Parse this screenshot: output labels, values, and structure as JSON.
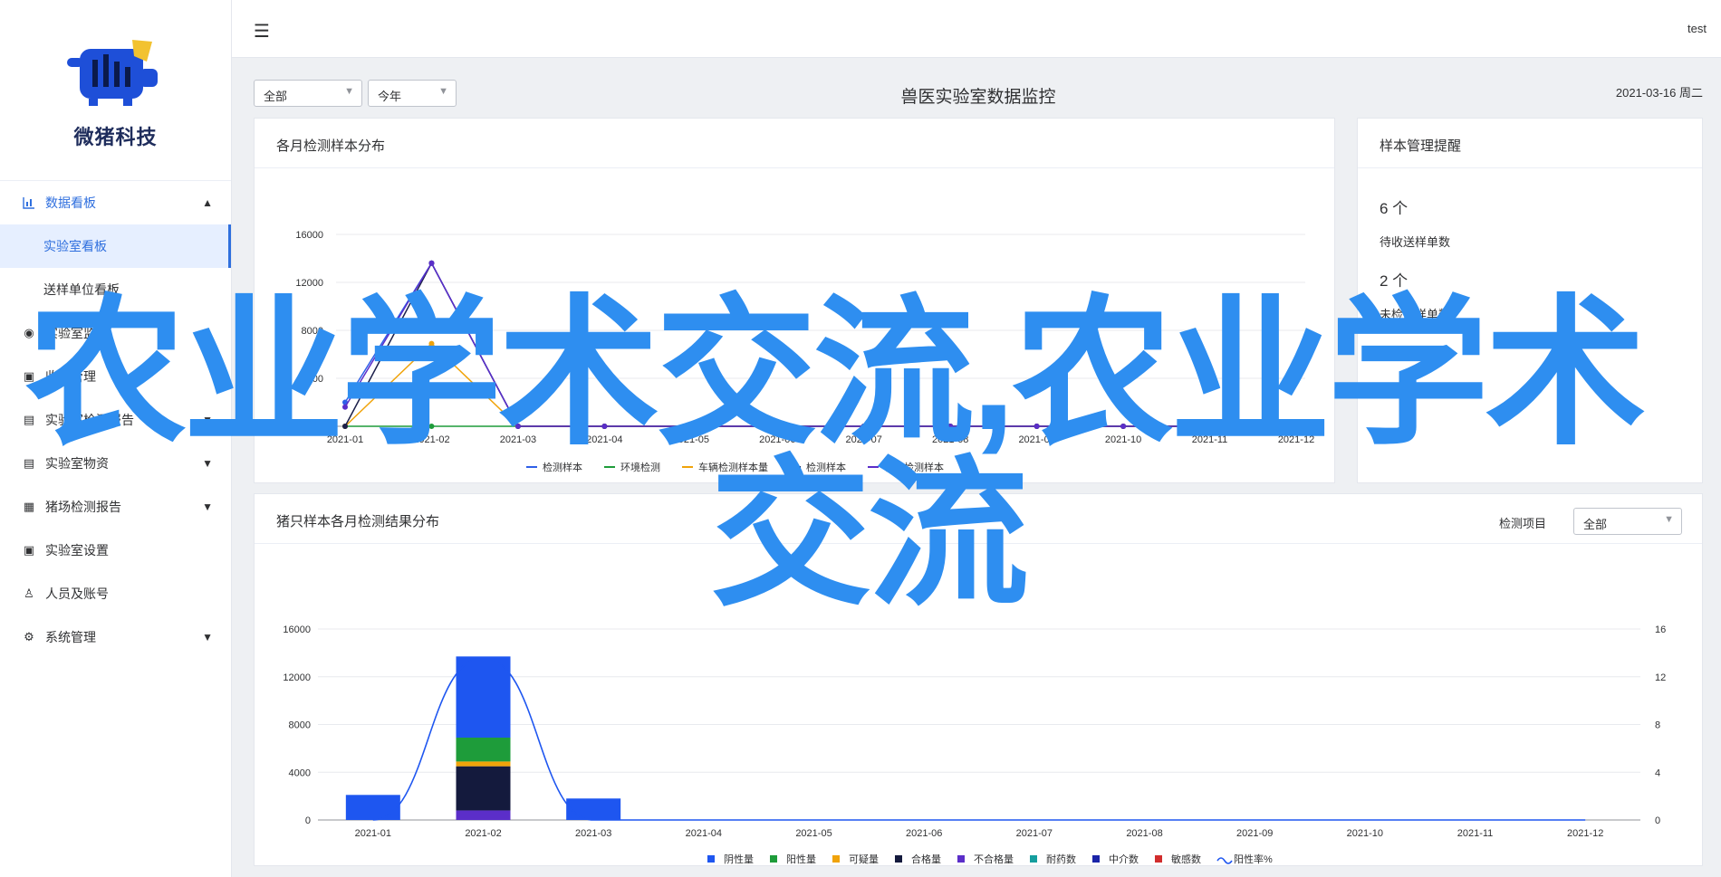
{
  "app": {
    "brand": "微猪科技",
    "user": "test"
  },
  "sidebar": {
    "items": [
      {
        "label": "数据看板",
        "icon": "bar-chart-icon"
      },
      {
        "label": "实验室看板"
      },
      {
        "label": "送样单位看板"
      },
      {
        "label": "实验室监控",
        "icon": "eye-icon"
      },
      {
        "label": "收样管理",
        "icon": "lock-icon"
      },
      {
        "label": "实验室检测报告",
        "icon": "document-icon"
      },
      {
        "label": "实验室物资",
        "icon": "document-icon"
      },
      {
        "label": "猪场检测报告",
        "icon": "report-icon"
      },
      {
        "label": "实验室设置",
        "icon": "lock-icon"
      },
      {
        "label": "人员及账号",
        "icon": "user-icon"
      },
      {
        "label": "系统管理",
        "icon": "gear-icon"
      }
    ]
  },
  "filters": {
    "scope": "全部",
    "period": "今年"
  },
  "page": {
    "title": "兽医实验室数据监控",
    "date": "2021-03-16 周二"
  },
  "sample_dist": {
    "title": "各月检测样本分布"
  },
  "reminder": {
    "title": "样本管理提醒",
    "pending_count": "6 个",
    "pending_label": "待收送样单数",
    "unchecked_count": "2 个",
    "unchecked_label": "未检送样单数"
  },
  "pig_dist": {
    "title": "猪只样本各月检测结果分布",
    "filter_label": "检测项目",
    "filter_value": "全部"
  },
  "watermark": {
    "line1": "农业学术交流,农业学术",
    "line2": "交流"
  },
  "chart_data": [
    {
      "type": "line",
      "categories": [
        "2021-01",
        "2021-02",
        "2021-03",
        "2021-04",
        "2021-05",
        "2021-06",
        "2021-07",
        "2021-08",
        "2021-09",
        "2021-10",
        "2021-11",
        "2021-12"
      ],
      "ylim": [
        0,
        16000
      ],
      "yticks": [
        0,
        4000,
        8000,
        12000,
        16000
      ],
      "series": [
        {
          "name": "检测样本",
          "color": "#2f5fe8",
          "values": [
            2000,
            13600,
            0,
            0,
            0,
            0,
            0,
            0,
            0,
            0,
            0,
            0
          ]
        },
        {
          "name": "环境检测",
          "color": "#1e9c3a",
          "values": [
            0,
            0,
            0,
            0,
            0,
            0,
            0,
            0,
            0,
            0,
            0,
            0
          ]
        },
        {
          "name": "车辆检测样本量",
          "color": "#f0a30a",
          "values": [
            0,
            6900,
            0,
            0,
            0,
            0,
            0,
            0,
            0,
            0,
            0,
            0
          ]
        },
        {
          "name": "检测样本",
          "color": "#1b1f4a",
          "values": [
            0,
            13600,
            0,
            0,
            0,
            0,
            0,
            0,
            0,
            0,
            0,
            0
          ]
        },
        {
          "name": "物资检测样本",
          "color": "#5b2ec9",
          "values": [
            1600,
            13600,
            0,
            0,
            0,
            0,
            0,
            0,
            0,
            0,
            0,
            0
          ]
        }
      ]
    },
    {
      "type": "bar",
      "categories": [
        "2021-01",
        "2021-02",
        "2021-03",
        "2021-04",
        "2021-05",
        "2021-06",
        "2021-07",
        "2021-08",
        "2021-09",
        "2021-10",
        "2021-11",
        "2021-12"
      ],
      "ylim": [
        0,
        16000
      ],
      "yticks": [
        0,
        4000,
        8000,
        12000,
        16000
      ],
      "y2lim": [
        0,
        16
      ],
      "y2ticks": [
        0,
        4,
        8,
        12,
        16
      ],
      "series": [
        {
          "name": "阴性量",
          "color": "#1e56f0",
          "values": [
            2100,
            6800,
            1800,
            0,
            0,
            0,
            0,
            0,
            0,
            0,
            0,
            0
          ]
        },
        {
          "name": "阳性量",
          "color": "#1e9c3a",
          "values": [
            0,
            2000,
            0,
            0,
            0,
            0,
            0,
            0,
            0,
            0,
            0,
            0
          ]
        },
        {
          "name": "可疑量",
          "color": "#f0a30a",
          "values": [
            0,
            400,
            0,
            0,
            0,
            0,
            0,
            0,
            0,
            0,
            0,
            0
          ]
        },
        {
          "name": "合格量",
          "color": "#141a3d",
          "values": [
            0,
            3700,
            0,
            0,
            0,
            0,
            0,
            0,
            0,
            0,
            0,
            0
          ]
        },
        {
          "name": "不合格量",
          "color": "#5b2ec9",
          "values": [
            0,
            800,
            0,
            0,
            0,
            0,
            0,
            0,
            0,
            0,
            0,
            0
          ]
        },
        {
          "name": "耐药数",
          "color": "#159e9e",
          "values": [
            0,
            0,
            0,
            0,
            0,
            0,
            0,
            0,
            0,
            0,
            0,
            0
          ]
        },
        {
          "name": "中介数",
          "color": "#1a24a8",
          "values": [
            0,
            0,
            0,
            0,
            0,
            0,
            0,
            0,
            0,
            0,
            0,
            0
          ]
        },
        {
          "name": "敏感数",
          "color": "#d12d2d",
          "values": [
            0,
            0,
            0,
            0,
            0,
            0,
            0,
            0,
            0,
            0,
            0,
            0
          ]
        }
      ],
      "line_series": {
        "name": "阳性率%",
        "color": "#1e56f0",
        "values": [
          0,
          13.6,
          0,
          0,
          0,
          0,
          0,
          0,
          0,
          0,
          0,
          0
        ]
      }
    }
  ]
}
